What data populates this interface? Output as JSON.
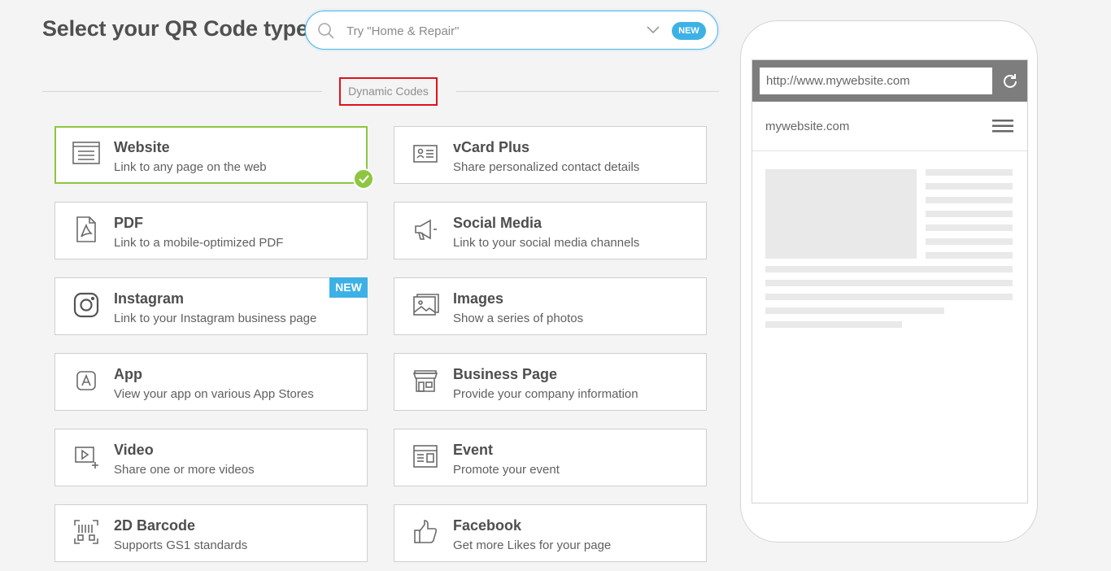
{
  "header": {
    "title": "Select your QR Code type",
    "search_placeholder": "Try \"Home & Repair\"",
    "new_badge": "NEW"
  },
  "section": {
    "label": "Dynamic Codes"
  },
  "cards": [
    {
      "id": "website",
      "title": "Website",
      "desc": "Link to any page on the web",
      "selected": true
    },
    {
      "id": "vcard",
      "title": "vCard Plus",
      "desc": "Share personalized contact details"
    },
    {
      "id": "pdf",
      "title": "PDF",
      "desc": "Link to a mobile-optimized PDF"
    },
    {
      "id": "social",
      "title": "Social Media",
      "desc": "Link to your social media channels"
    },
    {
      "id": "instagram",
      "title": "Instagram",
      "desc": "Link to your Instagram business page",
      "badge": "NEW"
    },
    {
      "id": "images",
      "title": "Images",
      "desc": "Show a series of photos"
    },
    {
      "id": "app",
      "title": "App",
      "desc": "View your app on various App Stores"
    },
    {
      "id": "business",
      "title": "Business Page",
      "desc": "Provide your company information"
    },
    {
      "id": "video",
      "title": "Video",
      "desc": "Share one or more videos"
    },
    {
      "id": "event",
      "title": "Event",
      "desc": "Promote your event"
    },
    {
      "id": "barcode",
      "title": "2D Barcode",
      "desc": "Supports GS1 standards"
    },
    {
      "id": "facebook",
      "title": "Facebook",
      "desc": "Get more Likes for your page"
    }
  ],
  "preview": {
    "url": "http://www.mywebsite.com",
    "site_name": "mywebsite.com"
  },
  "colors": {
    "accent_blue": "#3db1e6",
    "selected_green": "#8dc640",
    "highlight_red": "#e0121b"
  }
}
